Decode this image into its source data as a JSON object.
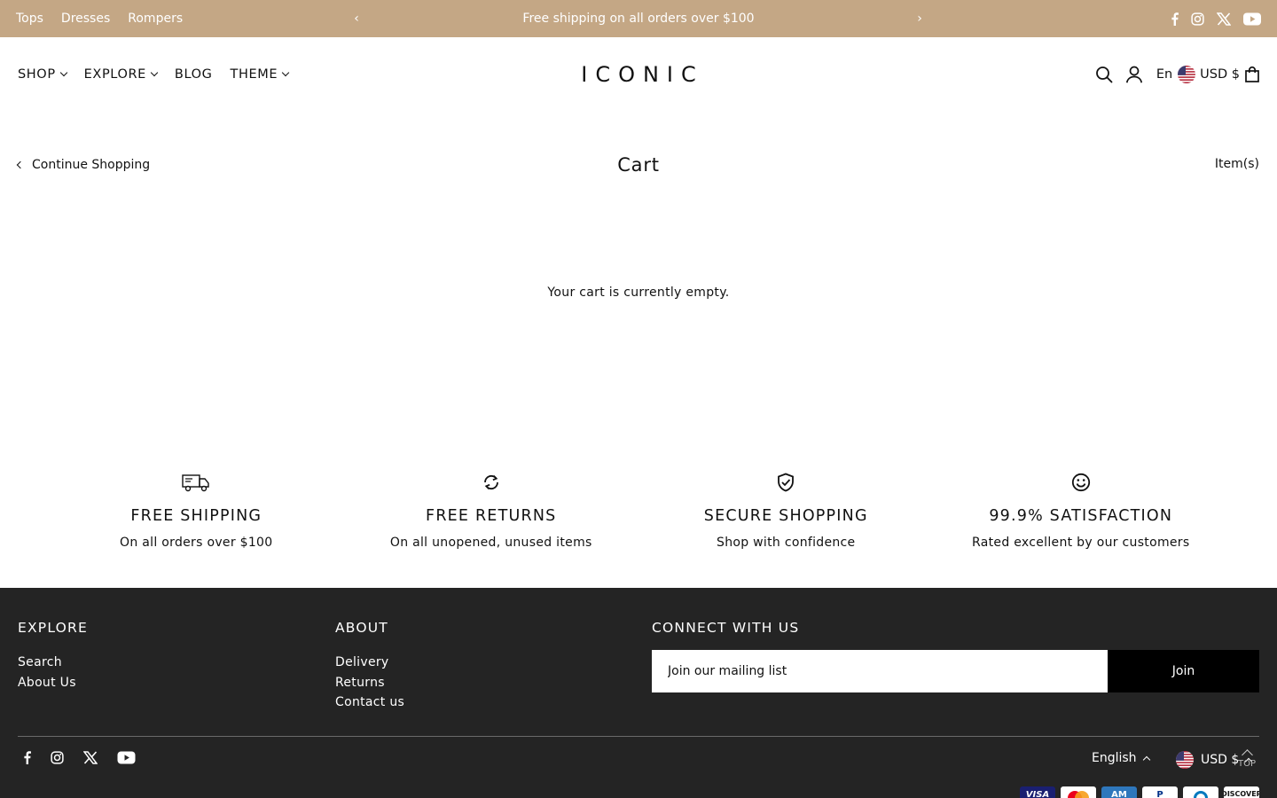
{
  "topbar": {
    "quick_links": [
      "Tops",
      "Dresses",
      "Rompers"
    ],
    "announcement": "Free shipping on all orders over $100",
    "prev": "‹",
    "next": "›"
  },
  "header": {
    "nav": [
      {
        "label": "SHOP",
        "dropdown": true
      },
      {
        "label": "EXPLORE",
        "dropdown": true
      },
      {
        "label": "BLOG",
        "dropdown": false
      },
      {
        "label": "THEME",
        "dropdown": true
      }
    ],
    "logo": "ICONIC",
    "language": "En",
    "currency": "USD $"
  },
  "cart": {
    "continue_label": "Continue Shopping",
    "title": "Cart",
    "items_label": "Item(s)",
    "empty_message": "Your cart is currently empty."
  },
  "features": [
    {
      "icon": "truck-icon",
      "title": "FREE SHIPPING",
      "subtitle": "On all orders over $100"
    },
    {
      "icon": "refresh-icon",
      "title": "FREE RETURNS",
      "subtitle": "On all unopened, unused items"
    },
    {
      "icon": "shield-check-icon",
      "title": "SECURE SHOPPING",
      "subtitle": "Shop with confidence"
    },
    {
      "icon": "smiley-icon",
      "title": "99.9% SATISFACTION",
      "subtitle": "Rated excellent by our customers"
    }
  ],
  "footer": {
    "explore": {
      "heading": "EXPLORE",
      "links": [
        "Search",
        "About Us"
      ]
    },
    "about": {
      "heading": "ABOUT",
      "links": [
        "Delivery",
        "Returns",
        "Contact us"
      ]
    },
    "connect": {
      "heading": "CONNECT WITH US",
      "placeholder": "Join our mailing list",
      "button": "Join"
    },
    "language": "English",
    "currency": "USD $",
    "to_top": "TOP",
    "payment_methods": [
      "Visa",
      "Mastercard",
      "American Express",
      "PayPal",
      "Diners Club",
      "Discover"
    ]
  },
  "colors": {
    "topbar_bg": "#c4a785",
    "footer_bg": "#242424",
    "button_bg": "#000000"
  }
}
